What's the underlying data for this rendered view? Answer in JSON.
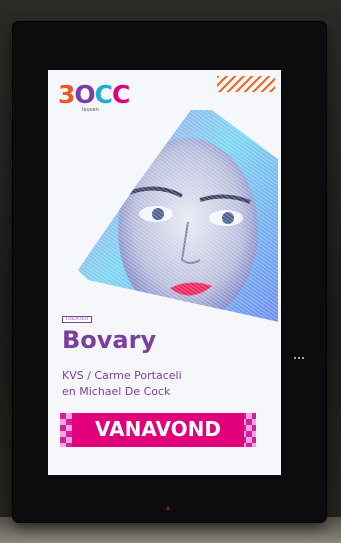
{
  "poster": {
    "logo": {
      "p1": "3",
      "p2": "O",
      "p3": "C",
      "p4": "C"
    },
    "logo_sub": "leuven",
    "category": "THEATER",
    "title": "Bovary",
    "credits_line1": "KVS / Carme Portaceli",
    "credits_line2": "en Michael De Cock",
    "banner": "VANAVOND"
  },
  "colors": {
    "purple": "#7a3fa1",
    "magenta": "#e2007a",
    "orange": "#e85a24",
    "cyan": "#1fb1c9"
  },
  "icons": [
    "stripes-decoration",
    "portrait-image"
  ]
}
